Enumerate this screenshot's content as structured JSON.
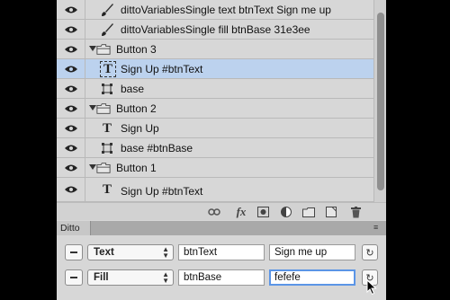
{
  "layers": [
    {
      "label": "dittoVariablesSingle text btnText Sign me up",
      "icon": "brush-icon"
    },
    {
      "label": "dittoVariablesSingle fill btnBase 31e3ee",
      "icon": "brush-icon"
    },
    {
      "label": "Button 3",
      "icon": "folder-icon",
      "group": true,
      "expanded": true
    },
    {
      "label": "Sign Up #btnText",
      "icon": "text-layer-icon",
      "selected": true
    },
    {
      "label": "base",
      "icon": "shape-layer-icon"
    },
    {
      "label": "Button 2",
      "icon": "folder-icon",
      "group": true,
      "expanded": true
    },
    {
      "label": "Sign Up",
      "icon": "text-layer-icon"
    },
    {
      "label": "base #btnBase",
      "icon": "shape-layer-icon"
    },
    {
      "label": "Button 1",
      "icon": "folder-icon",
      "group": true,
      "expanded": true
    },
    {
      "label": "Sign Up #btnText",
      "icon": "text-layer-icon"
    }
  ],
  "toolbar": {
    "fx_label": "fx",
    "icons": [
      "link-icon",
      "fx-icon",
      "mask-icon",
      "adjustment-icon",
      "new-group-icon",
      "new-layer-icon",
      "trash-icon"
    ]
  },
  "ditto": {
    "tab_label": "Ditto",
    "rows": [
      {
        "type": "Text",
        "variable": "btnText",
        "value": "Sign me up"
      },
      {
        "type": "Fill",
        "variable": "btnBase",
        "value": "fefefe"
      }
    ]
  },
  "colors": {
    "panel_bg": "#d7d7d7",
    "selected_row": "#bcd2ee",
    "focus_ring": "#5b95e6"
  }
}
